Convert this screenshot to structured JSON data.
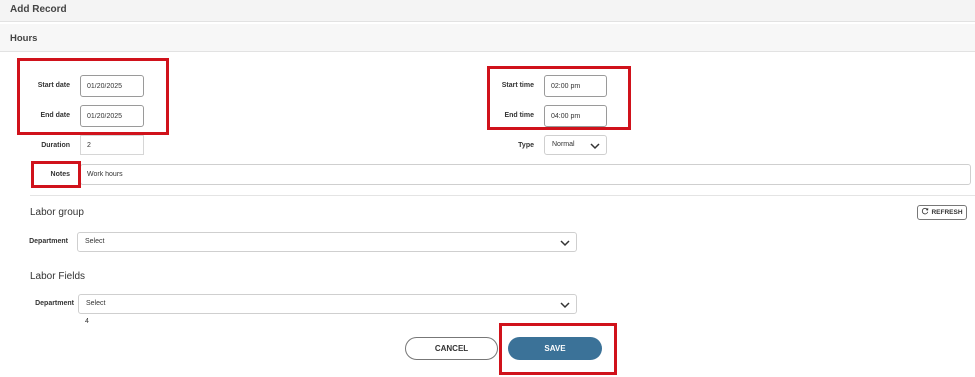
{
  "header": {
    "title": "Add Record"
  },
  "section": {
    "title": "Hours"
  },
  "form": {
    "start_date": {
      "label": "Start date",
      "value": "01/20/2025"
    },
    "end_date": {
      "label": "End date",
      "value": "01/20/2025"
    },
    "duration": {
      "label": "Duration",
      "value": "2"
    },
    "start_time": {
      "label": "Start time",
      "value": "02:00 pm"
    },
    "end_time": {
      "label": "End time",
      "value": "04:00 pm"
    },
    "type": {
      "label": "Type",
      "value": "Normal"
    },
    "notes": {
      "label": "Notes",
      "value": "Work hours"
    }
  },
  "labor_group": {
    "title": "Labor group",
    "refresh_label": "REFRESH",
    "department": {
      "label": "Department",
      "value": "Select"
    }
  },
  "labor_fields": {
    "title": "Labor Fields",
    "department": {
      "label": "Department",
      "value": "Select"
    },
    "sub_value": "4"
  },
  "actions": {
    "cancel_label": "CANCEL",
    "save_label": "SAVE"
  },
  "highlight_color": "#d0121b",
  "accent_color": "#3b7298"
}
